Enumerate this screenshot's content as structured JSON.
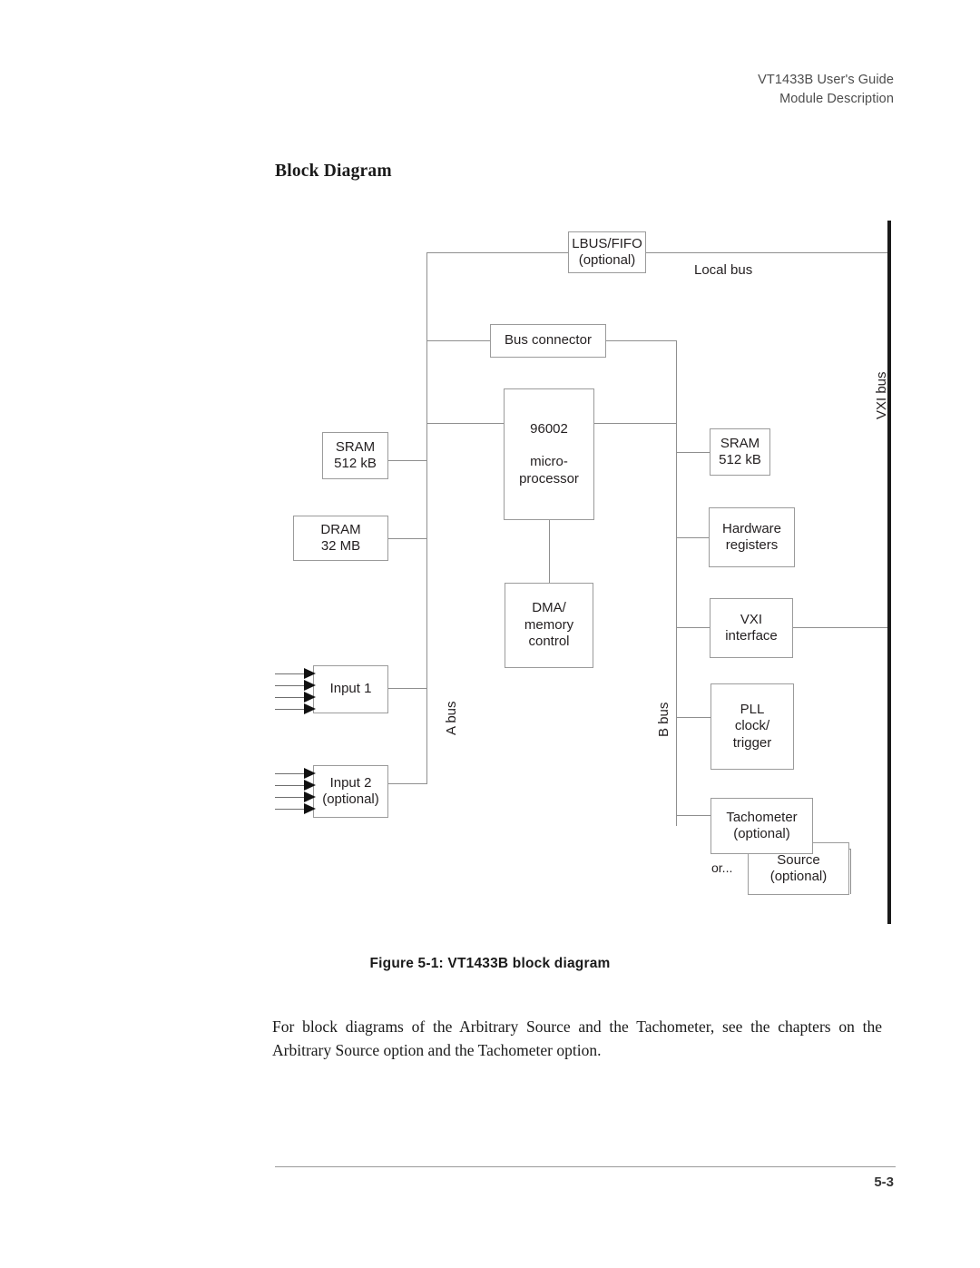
{
  "header": {
    "line1": "VT1433B User's Guide",
    "line2": "Module Description"
  },
  "section": {
    "heading": "Block Diagram"
  },
  "diagram": {
    "blocks": {
      "lbus_fifo": {
        "line1": "LBUS/FIFO",
        "line2": "(optional)"
      },
      "bus_connector": {
        "line1": "Bus connector"
      },
      "sram_left": {
        "line1": "SRAM",
        "line2": "512 kB"
      },
      "dram": {
        "line1": "DRAM",
        "line2": "32 MB"
      },
      "microprocessor": {
        "line1": "96002",
        "line2": "micro-",
        "line3": "processor"
      },
      "dma": {
        "line1": "DMA/",
        "line2": "memory",
        "line3": "control"
      },
      "input1": {
        "line1": "Input 1"
      },
      "input2": {
        "line1": "Input 2",
        "line2": "(optional)"
      },
      "sram_right": {
        "line1": "SRAM",
        "line2": "512 kB"
      },
      "hardware_registers": {
        "line1": "Hardware",
        "line2": "registers"
      },
      "vxi_interface": {
        "line1": "VXI",
        "line2": "interface"
      },
      "pll": {
        "line1": "PLL",
        "line2": "clock/",
        "line3": "trigger"
      },
      "tachometer": {
        "line1": "Tachometer",
        "line2": "(optional)"
      },
      "source": {
        "line1": "Source",
        "line2": "(optional)"
      }
    },
    "labels": {
      "local_bus": "Local bus",
      "vxi_bus": "VXI bus",
      "a_bus": "A bus",
      "b_bus": "B bus",
      "or": "or..."
    }
  },
  "figure": {
    "caption": "Figure 5-1:  VT1433B block diagram"
  },
  "body": {
    "paragraph": "For block diagrams of the Arbitrary Source and the Tachometer, see the chapters on the Arbitrary Source option and the Tachometer option."
  },
  "footer": {
    "page_number": "5-3"
  }
}
